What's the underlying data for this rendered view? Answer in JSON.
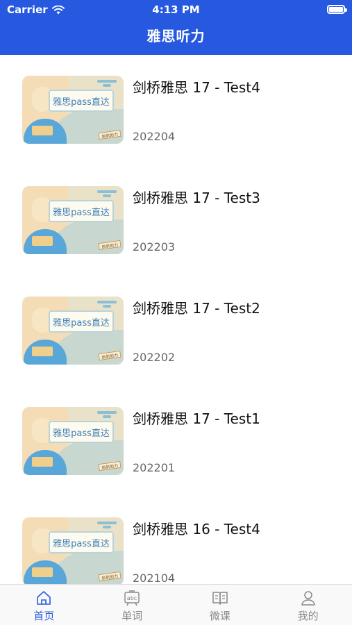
{
  "status_bar": {
    "carrier": "Carrier",
    "time": "4:13 PM"
  },
  "nav": {
    "title": "雅思听力"
  },
  "items": [
    {
      "title": "剑桥雅思 17 - Test4",
      "date": "202204",
      "thumb_text": "雅思pass直达",
      "thumb_tag": "启航助力"
    },
    {
      "title": "剑桥雅思 17 - Test3",
      "date": "202203",
      "thumb_text": "雅思pass直达",
      "thumb_tag": "启航助力"
    },
    {
      "title": "剑桥雅思 17 - Test2",
      "date": "202202",
      "thumb_text": "雅思pass直达",
      "thumb_tag": "启航助力"
    },
    {
      "title": "剑桥雅思 17 - Test1",
      "date": "202201",
      "thumb_text": "雅思pass直达",
      "thumb_tag": "启航助力"
    },
    {
      "title": "剑桥雅思 16 - Test4",
      "date": "202104",
      "thumb_text": "雅思pass直达",
      "thumb_tag": "启航助力"
    }
  ],
  "tabbar": {
    "tabs": [
      {
        "label": "首页",
        "icon": "home-icon",
        "active": true
      },
      {
        "label": "单词",
        "icon": "abc-board-icon",
        "active": false
      },
      {
        "label": "微课",
        "icon": "open-book-icon",
        "active": false
      },
      {
        "label": "我的",
        "icon": "person-icon",
        "active": false
      }
    ]
  },
  "colors": {
    "primary": "#2759E0",
    "inactive": "#888888"
  }
}
